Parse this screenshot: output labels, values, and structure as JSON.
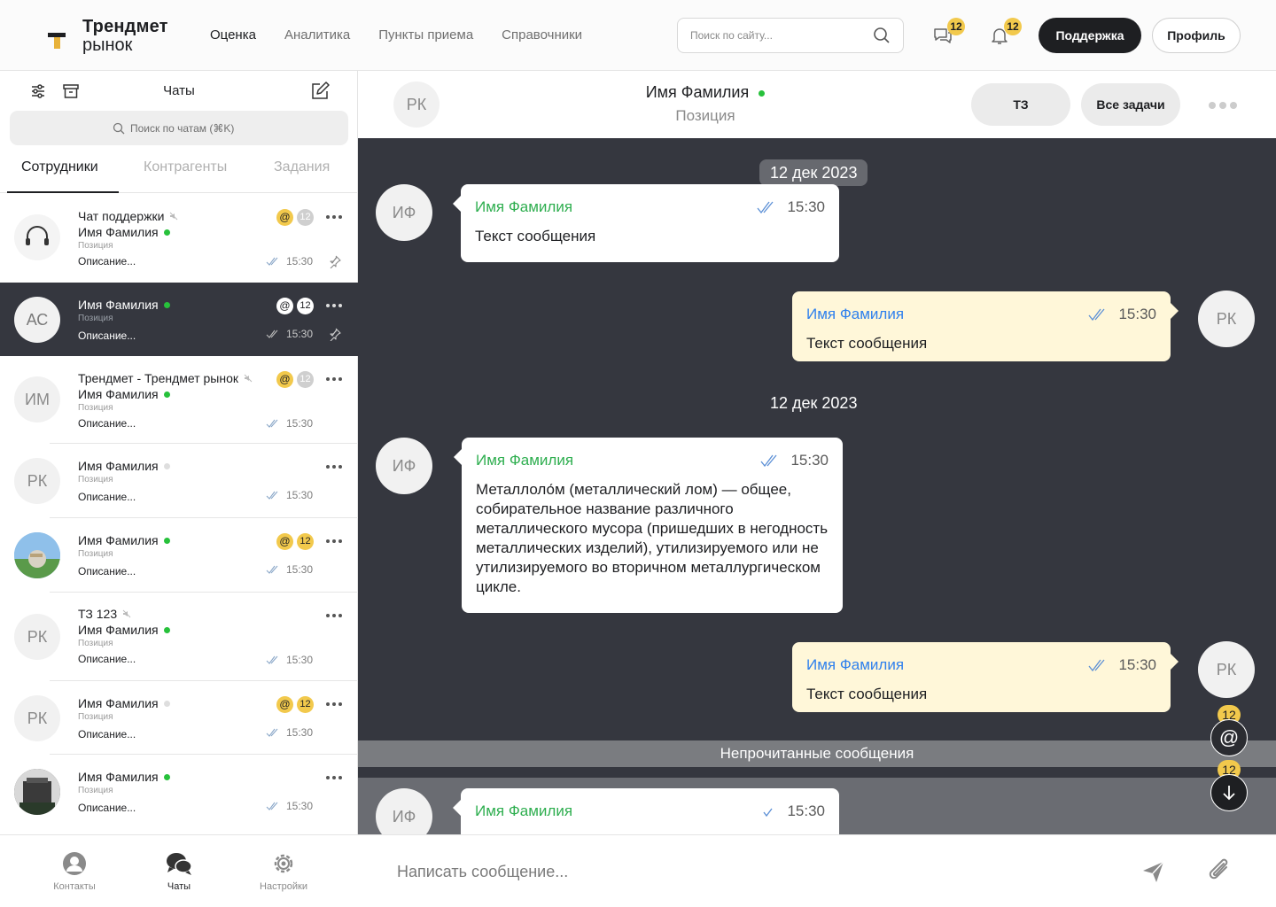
{
  "app": {
    "logo_line1": "Трендмет",
    "logo_line2": "рынок",
    "nav": [
      "Оценка",
      "Аналитика",
      "Пункты приема",
      "Справочники"
    ],
    "search_placeholder": "Поиск по сайту...",
    "messages_badge": "12",
    "notifications_badge": "12",
    "support_label": "Поддержка",
    "profile_label": "Профиль"
  },
  "sidebar": {
    "title": "Чаты",
    "search_placeholder": "Поиск по чатам (⌘K)",
    "tabs": [
      "Сотрудники",
      "Контрагенты",
      "Задания"
    ],
    "chats": [
      {
        "group": "Чат поддержки",
        "name": "Имя Фамилия",
        "position": "Позиция",
        "desc": "Описание...",
        "time": "15:30",
        "mention": "@",
        "count": "12"
      },
      {
        "initials": "АС",
        "name": "Имя Фамилия",
        "position": "Позиция",
        "desc": "Описание...",
        "time": "15:30",
        "mention": "@",
        "count": "12"
      },
      {
        "initials": "ИМ",
        "group": "Трендмет - Трендмет рынок",
        "name": "Имя Фамилия",
        "position": "Позиция",
        "desc": "Описание...",
        "time": "15:30",
        "mention": "@",
        "count": "12"
      },
      {
        "initials": "РК",
        "name": "Имя Фамилия",
        "position": "Позиция",
        "desc": "Описание...",
        "time": "15:30"
      },
      {
        "name": "Имя Фамилия",
        "position": "Позиция",
        "desc": "Описание...",
        "time": "15:30",
        "mention": "@",
        "count": "12"
      },
      {
        "initials": "РК",
        "group": "ТЗ 123",
        "name": "Имя Фамилия",
        "position": "Позиция",
        "desc": "Описание...",
        "time": "15:30"
      },
      {
        "initials": "РК",
        "name": "Имя Фамилия",
        "position": "Позиция",
        "desc": "Описание...",
        "time": "15:30",
        "mention": "@",
        "count": "12"
      },
      {
        "name": "Имя Фамилия",
        "position": "Позиция",
        "desc": "Описание...",
        "time": "15:30"
      }
    ],
    "bottom_nav": [
      "Контакты",
      "Чаты",
      "Настройки"
    ]
  },
  "chat": {
    "header_initials": "РК",
    "header_name": "Имя Фамилия",
    "header_position": "Позиция",
    "btn_tz": "ТЗ",
    "btn_tasks": "Все задачи",
    "date1": "12 дек 2023",
    "date2": "12 дек 2023",
    "messages": [
      {
        "initials": "ИФ",
        "name": "Имя Фамилия",
        "time": "15:30",
        "text": "Текст сообщения"
      },
      {
        "initials": "РК",
        "name": "Имя Фамилия",
        "time": "15:30",
        "text": "Текст сообщения"
      },
      {
        "initials": "ИФ",
        "name": "Имя Фамилия",
        "time": "15:30",
        "text": "Металлоло́м (металлический лом) — общее, собирательное название различного металлического мусора (пришедших в негодность металлических изделий), утилизируемого или не утилизируемого во вторичном металлургическом цикле."
      },
      {
        "initials": "РК",
        "name": "Имя Фамилия",
        "time": "15:30",
        "text": "Текст сообщения"
      },
      {
        "initials": "ИФ",
        "name": "Имя Фамилия",
        "time": "15:30"
      }
    ],
    "unread_label": "Непрочитанные сообщения",
    "mention_badge": "12",
    "scroll_badge": "12",
    "composer_placeholder": "Написать сообщение..."
  },
  "colors": {
    "dark": "#35373f",
    "accent_yellow": "#f2c94c",
    "own_bubble": "#fff7d9",
    "name_green": "#2eae4f",
    "name_blue": "#2f80ed",
    "online": "#27c13b"
  }
}
